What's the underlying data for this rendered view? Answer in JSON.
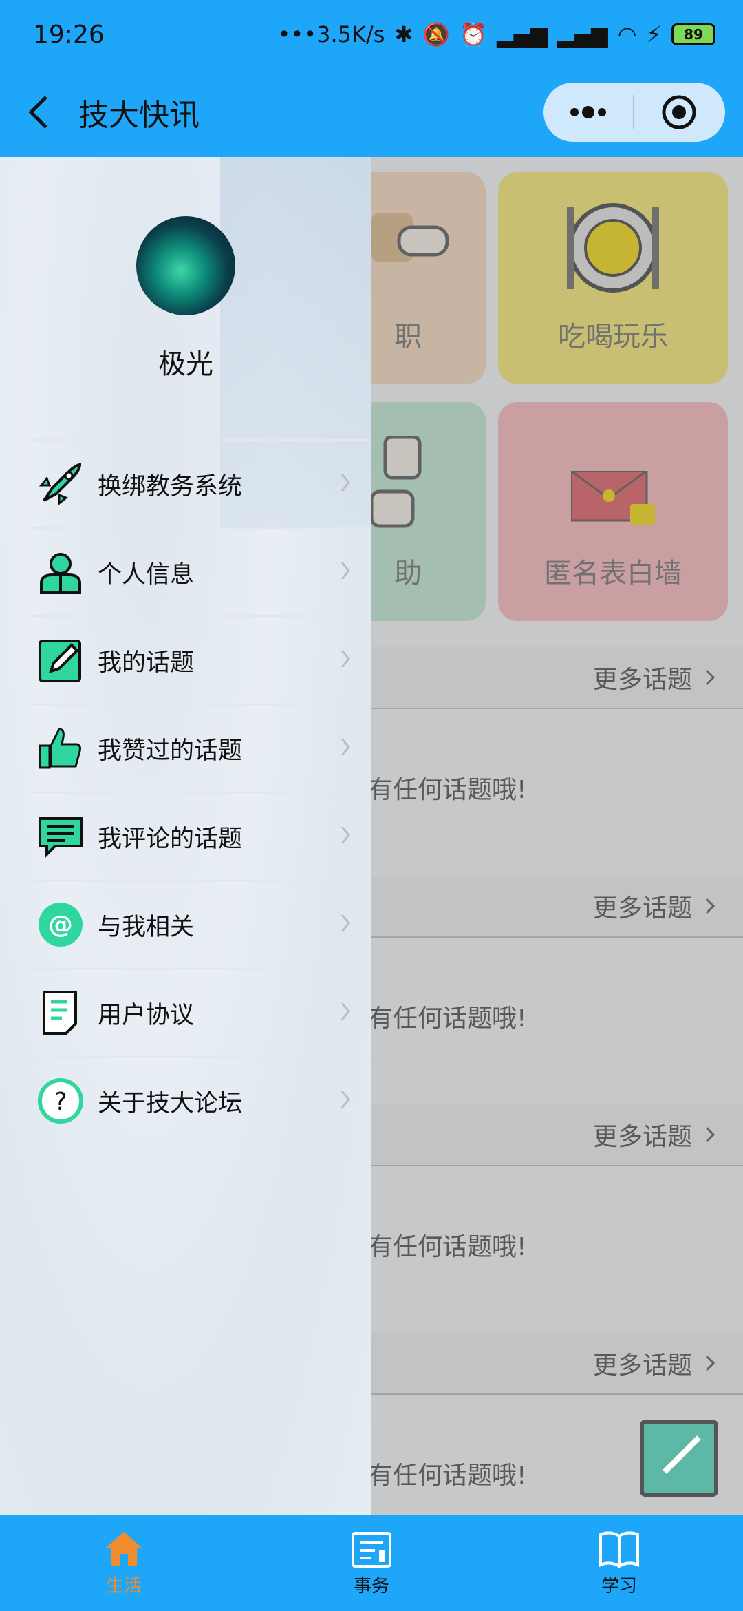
{
  "status": {
    "time": "19:26",
    "net_speed": "3.5K/s",
    "battery": "89"
  },
  "header": {
    "title": "技大快讯"
  },
  "background": {
    "cards": [
      "职",
      "吃喝玩乐",
      "助",
      "匿名表白墙"
    ],
    "sections": [
      {
        "more": "更多话题",
        "empty": "有任何话题哦!"
      },
      {
        "more": "更多话题",
        "empty": "有任何话题哦!"
      },
      {
        "more": "更多话题",
        "empty": "有任何话题哦!"
      },
      {
        "more": "更多话题",
        "empty": "有任何话题哦!"
      }
    ]
  },
  "drawer": {
    "username": "极光",
    "items": [
      {
        "label": "换绑教务系统",
        "icon": "rocket-icon"
      },
      {
        "label": "个人信息",
        "icon": "person-icon"
      },
      {
        "label": "我的话题",
        "icon": "edit-icon"
      },
      {
        "label": "我赞过的话题",
        "icon": "thumbs-up-icon"
      },
      {
        "label": "我评论的话题",
        "icon": "comment-icon"
      },
      {
        "label": "与我相关",
        "icon": "at-icon"
      },
      {
        "label": "用户协议",
        "icon": "document-icon"
      },
      {
        "label": "关于技大论坛",
        "icon": "question-icon"
      }
    ]
  },
  "tabs": [
    {
      "label": "生活",
      "icon": "home-icon",
      "active": true
    },
    {
      "label": "事务",
      "icon": "clipboard-icon",
      "active": false
    },
    {
      "label": "学习",
      "icon": "book-icon",
      "active": false
    }
  ],
  "colors": {
    "accent": "#1ea7f8",
    "icon_teal": "#2fd6a0",
    "active_tab": "#f08c2e"
  }
}
